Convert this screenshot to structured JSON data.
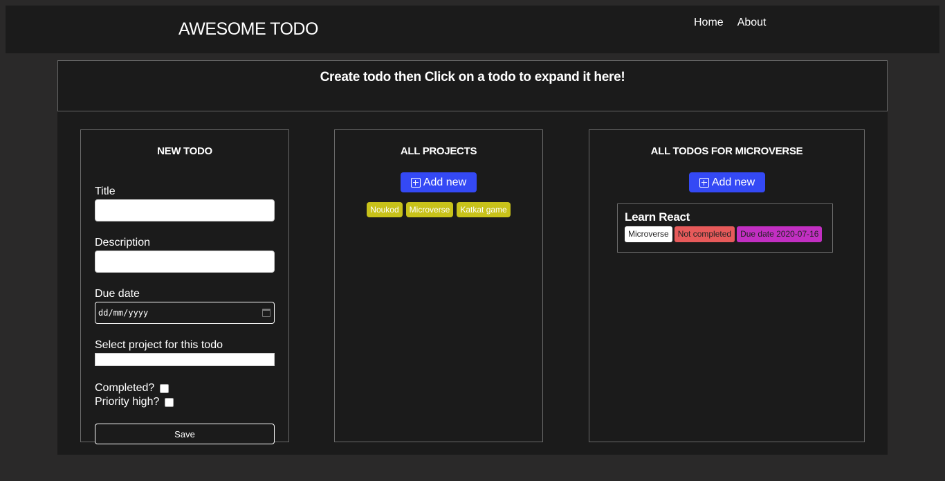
{
  "header": {
    "brand": "AWESOME TODO",
    "nav": [
      {
        "label": "Home"
      },
      {
        "label": "About"
      }
    ]
  },
  "banner": {
    "text": "Create todo then Click on a todo to expand it here!"
  },
  "new_todo": {
    "title": "NEW TODO",
    "fields": {
      "title_label": "Title",
      "description_label": "Description",
      "due_date_label": "Due date",
      "due_date_placeholder": "dd/mm/yyyy",
      "project_label": "Select project for this todo",
      "completed_label": "Completed?",
      "priority_label": "Priority high?"
    },
    "save_label": "Save"
  },
  "projects": {
    "title": "ALL PROJECTS",
    "add_label": "Add new",
    "items": [
      "Noukod",
      "Microverse",
      "Katkat game"
    ]
  },
  "todos": {
    "title": "ALL TODOS FOR MICROVERSE",
    "add_label": "Add new",
    "items": [
      {
        "title": "Learn React",
        "project": "Microverse",
        "status": "Not completed",
        "due": "Due date 2020-07-16"
      }
    ]
  },
  "colors": {
    "page_bg": "#2a2929",
    "panel_bg": "#1b1b1b",
    "add_button": "#3449f5",
    "project_tag": "#c8c21a",
    "status_not_completed": "#e75a5a",
    "due_badge": "#c22fc2"
  }
}
